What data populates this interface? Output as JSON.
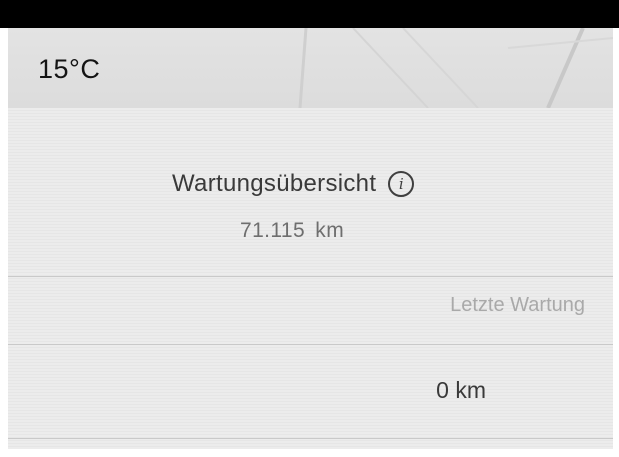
{
  "status_bar": {
    "temperature": "15°C"
  },
  "maintenance": {
    "title": "Wartungsübersicht",
    "info_icon": "info-icon",
    "odometer": "71.115  km",
    "last_service_label": "Letzte Wartung",
    "last_service_value": "0 km"
  }
}
